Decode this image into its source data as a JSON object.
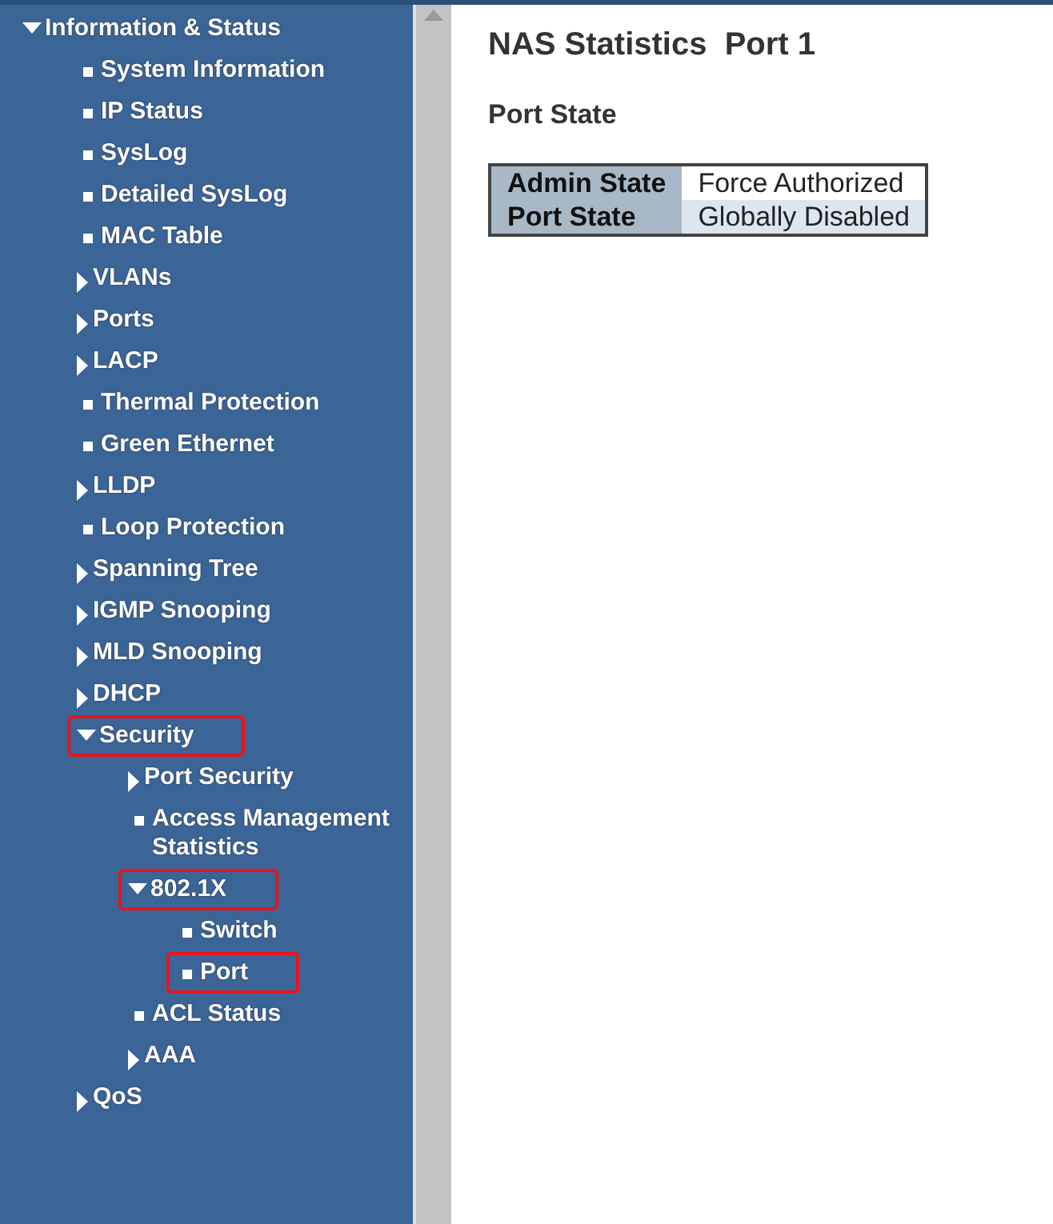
{
  "sidebar": {
    "items": [
      {
        "label": "Information & Status",
        "kind": "folder",
        "expanded": true,
        "highlighted": false,
        "children": [
          {
            "label": "System Information",
            "kind": "page",
            "highlighted": false
          },
          {
            "label": "IP Status",
            "kind": "page",
            "highlighted": false
          },
          {
            "label": "SysLog",
            "kind": "page",
            "highlighted": false
          },
          {
            "label": "Detailed SysLog",
            "kind": "page",
            "highlighted": false
          },
          {
            "label": "MAC Table",
            "kind": "page",
            "highlighted": false
          },
          {
            "label": "VLANs",
            "kind": "folder",
            "expanded": false,
            "highlighted": false
          },
          {
            "label": "Ports",
            "kind": "folder",
            "expanded": false,
            "highlighted": false
          },
          {
            "label": "LACP",
            "kind": "folder",
            "expanded": false,
            "highlighted": false
          },
          {
            "label": "Thermal Protection",
            "kind": "page",
            "highlighted": false
          },
          {
            "label": "Green Ethernet",
            "kind": "page",
            "highlighted": false
          },
          {
            "label": "LLDP",
            "kind": "folder",
            "expanded": false,
            "highlighted": false
          },
          {
            "label": "Loop Protection",
            "kind": "page",
            "highlighted": false
          },
          {
            "label": "Spanning Tree",
            "kind": "folder",
            "expanded": false,
            "highlighted": false
          },
          {
            "label": "IGMP Snooping",
            "kind": "folder",
            "expanded": false,
            "highlighted": false
          },
          {
            "label": "MLD Snooping",
            "kind": "folder",
            "expanded": false,
            "highlighted": false
          },
          {
            "label": "DHCP",
            "kind": "folder",
            "expanded": false,
            "highlighted": false
          },
          {
            "label": "Security",
            "kind": "folder",
            "expanded": true,
            "highlighted": true,
            "children": [
              {
                "label": "Port Security",
                "kind": "folder",
                "expanded": false,
                "highlighted": false
              },
              {
                "label": "Access Management Statistics",
                "kind": "page",
                "highlighted": false
              },
              {
                "label": "802.1X",
                "kind": "folder",
                "expanded": true,
                "highlighted": true,
                "children": [
                  {
                    "label": "Switch",
                    "kind": "page",
                    "highlighted": false
                  },
                  {
                    "label": "Port",
                    "kind": "page",
                    "highlighted": true
                  }
                ]
              },
              {
                "label": "ACL Status",
                "kind": "page",
                "highlighted": false
              },
              {
                "label": "AAA",
                "kind": "folder",
                "expanded": false,
                "highlighted": false
              }
            ]
          },
          {
            "label": "QoS",
            "kind": "folder",
            "expanded": false,
            "highlighted": false
          }
        ]
      }
    ]
  },
  "main": {
    "title": "NAS Statistics  Port 1",
    "section": "Port State",
    "table": {
      "rows": [
        {
          "label": "Admin State",
          "value": "Force Authorized"
        },
        {
          "label": "Port State",
          "value": "Globally Disabled"
        }
      ]
    }
  }
}
